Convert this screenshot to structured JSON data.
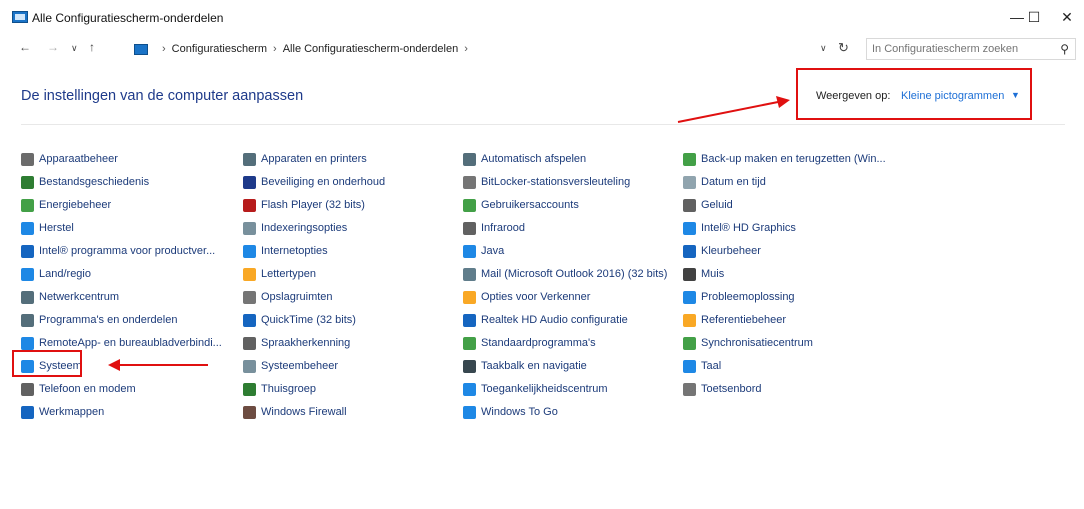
{
  "window": {
    "title": "Alle Configuratiescherm-onderdelen"
  },
  "address": {
    "breadcrumbs": [
      "Configuratiescherm",
      "Alle Configuratiescherm-onderdelen"
    ]
  },
  "search": {
    "placeholder": "In Configuratiescherm zoeken"
  },
  "header": {
    "title": "De instellingen van de computer aanpassen",
    "view_label": "Weergeven op:",
    "view_value": "Kleine pictogrammen"
  },
  "items": [
    [
      {
        "label": "Apparaatbeheer",
        "color": "#6b6b6b"
      },
      {
        "label": "Bestandsgeschiedenis",
        "color": "#2e7d32"
      },
      {
        "label": "Energiebeheer",
        "color": "#43a047"
      },
      {
        "label": "Herstel",
        "color": "#1e88e5"
      },
      {
        "label": "Intel® programma voor productver...",
        "color": "#1565c0"
      },
      {
        "label": "Land/regio",
        "color": "#1e88e5"
      },
      {
        "label": "Netwerkcentrum",
        "color": "#546e7a"
      },
      {
        "label": "Programma's en onderdelen",
        "color": "#546e7a"
      },
      {
        "label": "RemoteApp- en bureaubladverbindi...",
        "color": "#1e88e5"
      },
      {
        "label": "Systeem",
        "color": "#1e88e5"
      },
      {
        "label": "Telefoon en modem",
        "color": "#616161"
      },
      {
        "label": "Werkmappen",
        "color": "#1565c0"
      }
    ],
    [
      {
        "label": "Apparaten en printers",
        "color": "#546e7a"
      },
      {
        "label": "Beveiliging en onderhoud",
        "color": "#1e3a8a"
      },
      {
        "label": "Flash Player (32 bits)",
        "color": "#b71c1c"
      },
      {
        "label": "Indexeringsopties",
        "color": "#78909c"
      },
      {
        "label": "Internetopties",
        "color": "#1e88e5"
      },
      {
        "label": "Lettertypen",
        "color": "#f9a825"
      },
      {
        "label": "Opslagruimten",
        "color": "#757575"
      },
      {
        "label": "QuickTime (32 bits)",
        "color": "#1565c0"
      },
      {
        "label": "Spraakherkenning",
        "color": "#616161"
      },
      {
        "label": "Systeembeheer",
        "color": "#78909c"
      },
      {
        "label": "Thuisgroep",
        "color": "#2e7d32"
      },
      {
        "label": "Windows Firewall",
        "color": "#6d4c41"
      }
    ],
    [
      {
        "label": "Automatisch afspelen",
        "color": "#546e7a"
      },
      {
        "label": "BitLocker-stationsversleuteling",
        "color": "#757575"
      },
      {
        "label": "Gebruikersaccounts",
        "color": "#43a047"
      },
      {
        "label": "Infrarood",
        "color": "#616161"
      },
      {
        "label": "Java",
        "color": "#1e88e5"
      },
      {
        "label": "Mail (Microsoft Outlook 2016) (32 bits)",
        "color": "#607d8b"
      },
      {
        "label": "Opties voor Verkenner",
        "color": "#f9a825"
      },
      {
        "label": "Realtek HD Audio configuratie",
        "color": "#1565c0"
      },
      {
        "label": "Standaardprogramma's",
        "color": "#43a047"
      },
      {
        "label": "Taakbalk en navigatie",
        "color": "#37474f"
      },
      {
        "label": "Toegankelijkheidscentrum",
        "color": "#1e88e5"
      },
      {
        "label": "Windows To Go",
        "color": "#1e88e5"
      }
    ],
    [
      {
        "label": "Back-up maken en terugzetten (Win...",
        "color": "#43a047"
      },
      {
        "label": "Datum en tijd",
        "color": "#90a4ae"
      },
      {
        "label": "Geluid",
        "color": "#616161"
      },
      {
        "label": "Intel® HD Graphics",
        "color": "#1e88e5"
      },
      {
        "label": "Kleurbeheer",
        "color": "#1565c0"
      },
      {
        "label": "Muis",
        "color": "#424242"
      },
      {
        "label": "Probleemoplossing",
        "color": "#1e88e5"
      },
      {
        "label": "Referentiebeheer",
        "color": "#f9a825"
      },
      {
        "label": "Synchronisatiecentrum",
        "color": "#43a047"
      },
      {
        "label": "Taal",
        "color": "#1e88e5"
      },
      {
        "label": "Toetsenbord",
        "color": "#757575"
      }
    ]
  ],
  "highlight_color": "#e01010",
  "link_color": "#1c3b7a"
}
